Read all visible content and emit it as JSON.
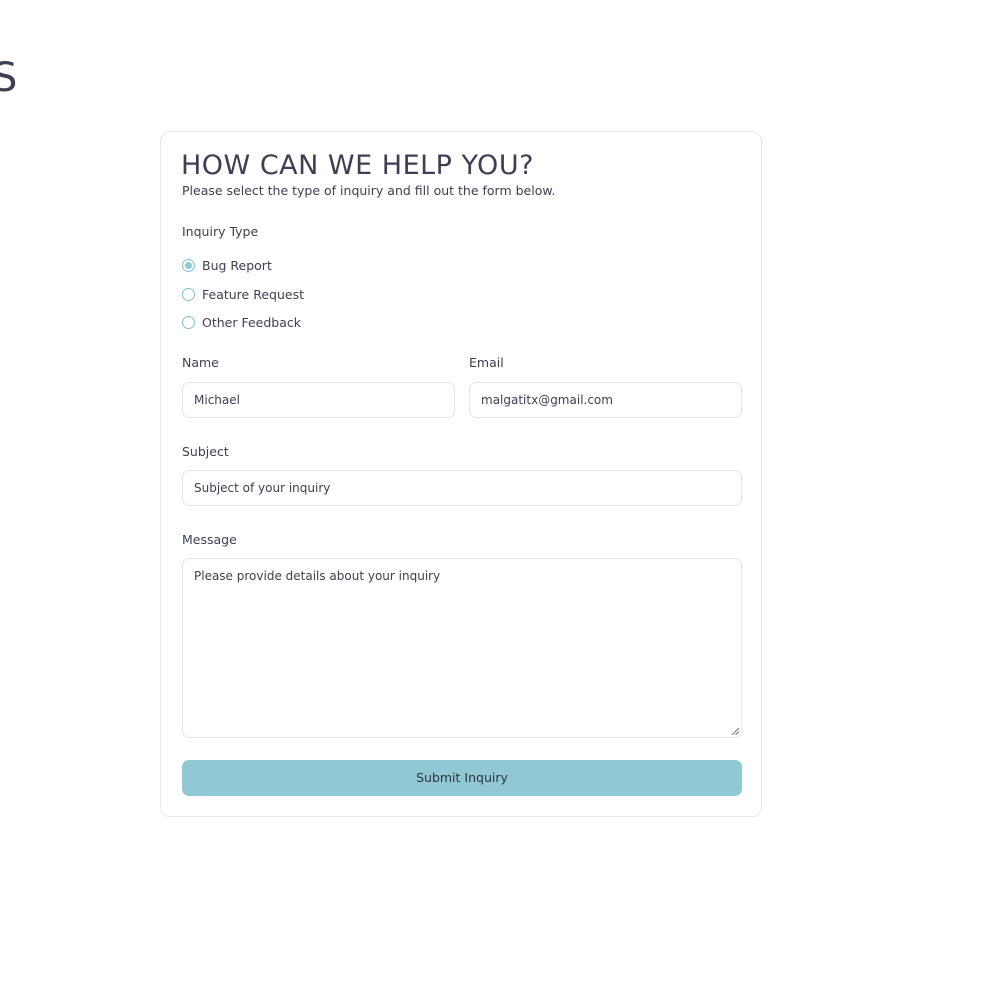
{
  "page": {
    "clipped_heading": "S"
  },
  "form": {
    "title": "HOW CAN WE HELP YOU?",
    "subtitle": "Please select the type of inquiry and fill out the form below.",
    "inquiry_type": {
      "label": "Inquiry Type",
      "options": [
        {
          "label": "Bug Report",
          "checked": true
        },
        {
          "label": "Feature Request",
          "checked": false
        },
        {
          "label": "Other Feedback",
          "checked": false
        }
      ]
    },
    "name": {
      "label": "Name",
      "value": "Michael"
    },
    "email": {
      "label": "Email",
      "value": "malgatitx@gmail.com"
    },
    "subject": {
      "label": "Subject",
      "placeholder": "Subject of your inquiry"
    },
    "message": {
      "label": "Message",
      "placeholder": "Please provide details about your inquiry"
    },
    "submit_label": "Submit Inquiry"
  },
  "colors": {
    "accent": "#90c8d3",
    "text": "#3d3f52",
    "border": "#e3e6ea"
  }
}
